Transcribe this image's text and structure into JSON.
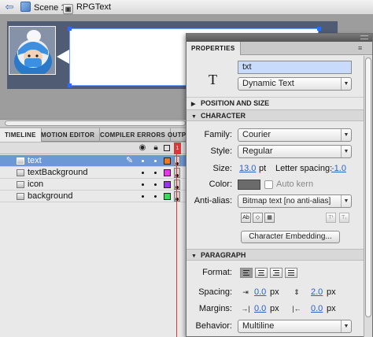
{
  "breadcrumb": {
    "scene_label": "Scene 1",
    "symbol_label": "RPGText"
  },
  "timeline": {
    "tabs": [
      {
        "label": "TIMELINE",
        "active": true
      },
      {
        "label": "MOTION EDITOR",
        "active": false
      },
      {
        "label": "COMPILER ERRORS",
        "active": false
      },
      {
        "label": "OUTPU",
        "active": false
      }
    ],
    "current_frame": "1",
    "layers": [
      {
        "name": "text",
        "selected": true,
        "color": "#f07820"
      },
      {
        "name": "textBackground",
        "selected": false,
        "color": "#ee33ee"
      },
      {
        "name": "icon",
        "selected": false,
        "color": "#9a33ee"
      },
      {
        "name": "background",
        "selected": false,
        "color": "#33dd55"
      }
    ]
  },
  "properties": {
    "tab_label": "PROPERTIES",
    "instance_name": "txt",
    "text_type": "Dynamic Text",
    "sections": {
      "position_size": "POSITION AND SIZE",
      "character": "CHARACTER",
      "paragraph": "PARAGRAPH"
    },
    "character": {
      "family_label": "Family:",
      "family_value": "Courier",
      "style_label": "Style:",
      "style_value": "Regular",
      "size_label": "Size:",
      "size_value": "13.0",
      "size_unit": "pt",
      "letter_spacing_label": "Letter spacing:",
      "letter_spacing_value": "-1.0",
      "color_label": "Color:",
      "color_value": "#6b6b6b",
      "auto_kern_label": "Auto kern",
      "anti_alias_label": "Anti-alias:",
      "anti_alias_value": "Bitmap text [no anti-alias]",
      "embed_button": "Character Embedding..."
    },
    "paragraph": {
      "format_label": "Format:",
      "spacing_label": "Spacing:",
      "spacing_indent": "0.0",
      "spacing_line": "2.0",
      "margins_label": "Margins:",
      "margin_left": "0.0",
      "margin_right": "0.0",
      "unit_px": "px",
      "behavior_label": "Behavior:",
      "behavior_value": "Multiline"
    }
  }
}
